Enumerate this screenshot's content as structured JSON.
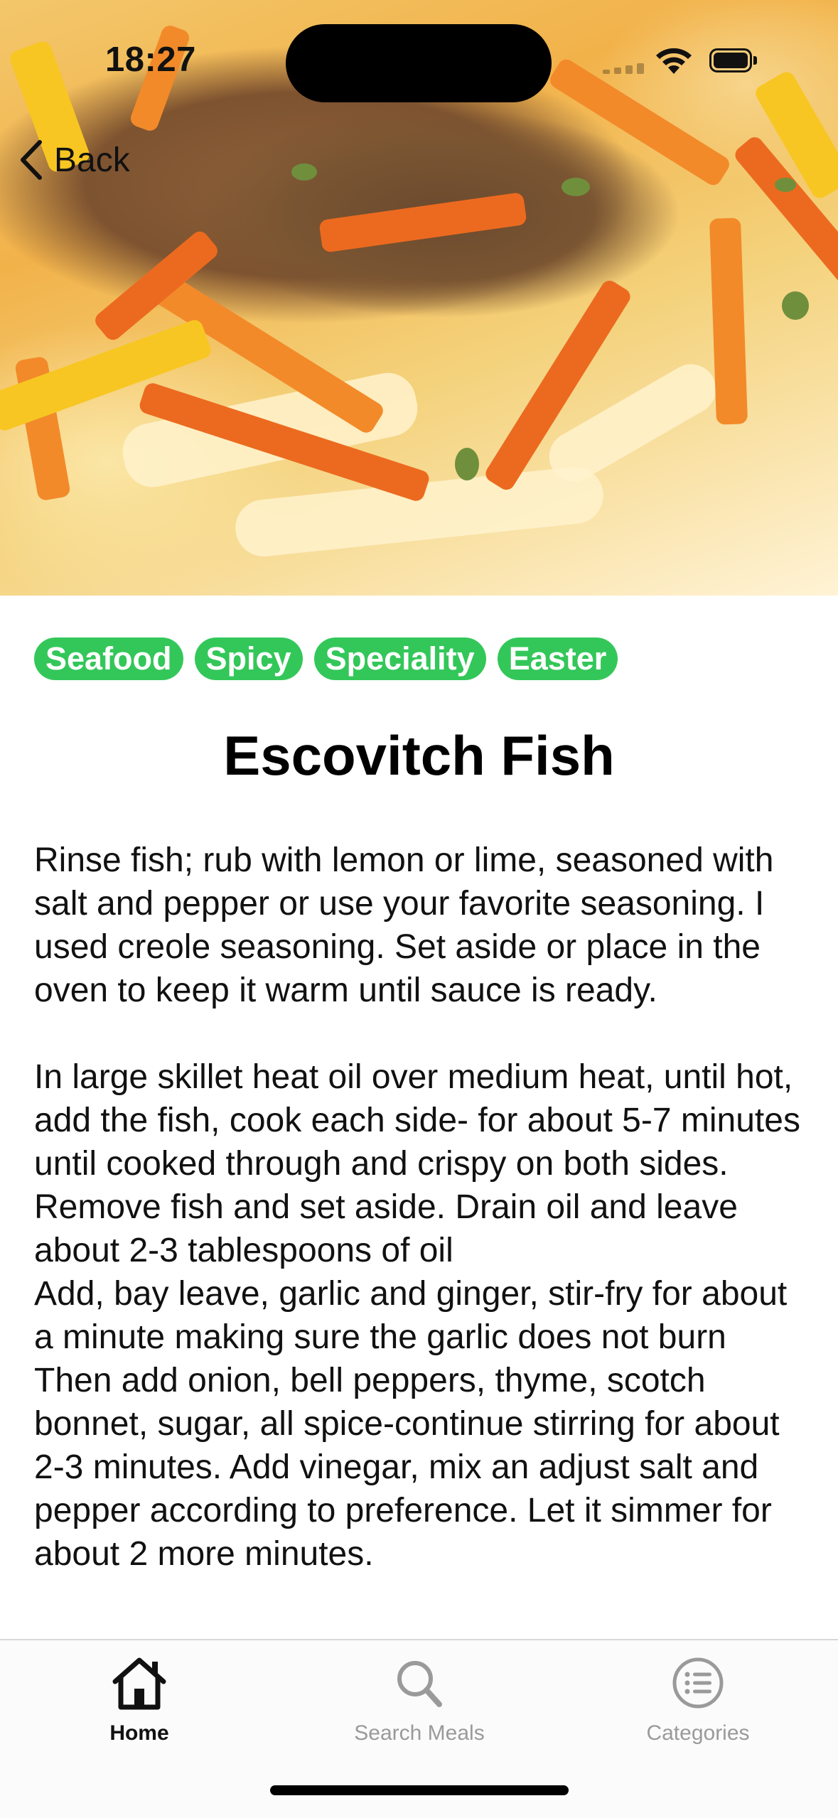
{
  "status_bar": {
    "time": "18:27",
    "icons": [
      "cellular-signal-icon",
      "wifi-icon",
      "battery-icon"
    ]
  },
  "nav": {
    "back_label": "Back",
    "back_icon": "chevron-left-icon"
  },
  "hero_image": {
    "subject": "fried fish with carrots, peppers and onions"
  },
  "tags": [
    "Seafood",
    "Spicy",
    "Speciality",
    "Easter"
  ],
  "meal": {
    "title": "Escovitch Fish",
    "instructions": "Rinse fish; rub with lemon or lime, seasoned with salt and pepper or use your favorite seasoning. I used creole seasoning. Set aside or place in the oven to keep it warm until sauce is ready.\n\nIn large skillet heat oil over medium heat, until hot, add the fish, cook each side- for about 5-7 minutes until cooked through and crispy on both sides. Remove fish and set aside. Drain oil and leave about 2-3 tablespoons of oil\nAdd, bay leave, garlic and ginger, stir-fry for about a minute making sure the garlic does not burn\nThen add onion, bell peppers, thyme, scotch bonnet, sugar, all spice-continue stirring for about 2-3 minutes. Add vinegar, mix an adjust salt and pepper according to preference. Let it simmer for about 2 more minutes."
  },
  "tab_bar": {
    "tabs": [
      {
        "label": "Home",
        "icon": "house-icon",
        "active": true
      },
      {
        "label": "Search Meals",
        "icon": "magnifier-icon",
        "active": false
      },
      {
        "label": "Categories",
        "icon": "list-circle-icon",
        "active": false
      }
    ]
  },
  "colors": {
    "tag_green": "#33c759",
    "inactive_tab": "#9a9a9a"
  }
}
